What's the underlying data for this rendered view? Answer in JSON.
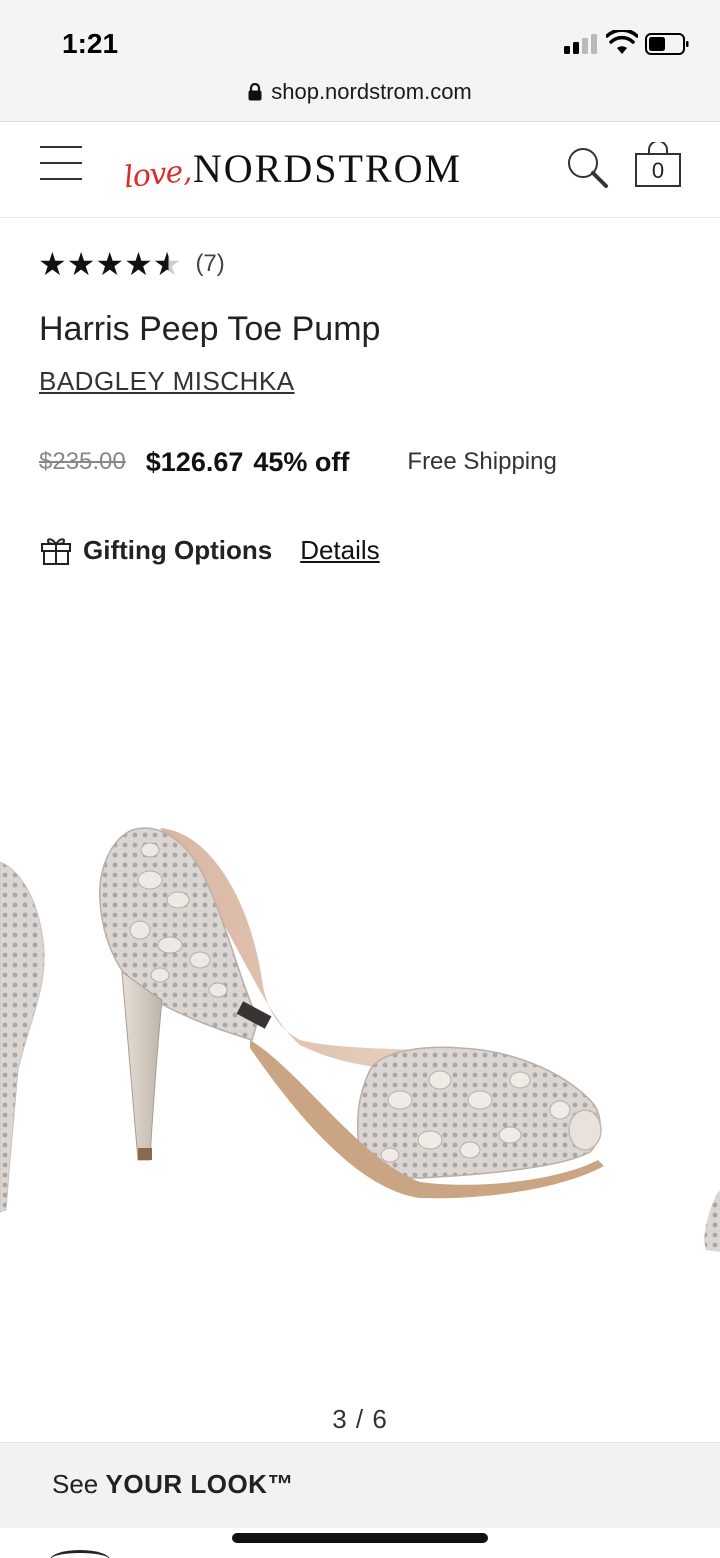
{
  "status_bar": {
    "time": "1:21",
    "url": "shop.nordstrom.com"
  },
  "header": {
    "logo_love": "love,",
    "logo_brand": "NORDSTROM",
    "bag_count": "0",
    "accent_color": "#d6302d"
  },
  "product": {
    "rating_value": 4.5,
    "rating_max": 5,
    "review_count": "(7)",
    "title": "Harris Peep Toe Pump",
    "brand": "BADGLEY MISCHKA",
    "price_original": "$235.00",
    "price_sale": "$126.67",
    "discount": "45% off",
    "shipping": "Free Shipping"
  },
  "gifting": {
    "label": "Gifting Options",
    "details_link": "Details"
  },
  "gallery": {
    "pager": "3 / 6",
    "image_subject": "silver embellished peep toe d'orsay pump"
  },
  "your_look": {
    "prefix": "See",
    "label": "YOUR LOOK™"
  },
  "icons": [
    "hamburger-icon",
    "search-icon",
    "bag-icon",
    "gift-icon",
    "lock-icon",
    "signal-icon",
    "wifi-icon",
    "battery-icon",
    "star-icon"
  ]
}
